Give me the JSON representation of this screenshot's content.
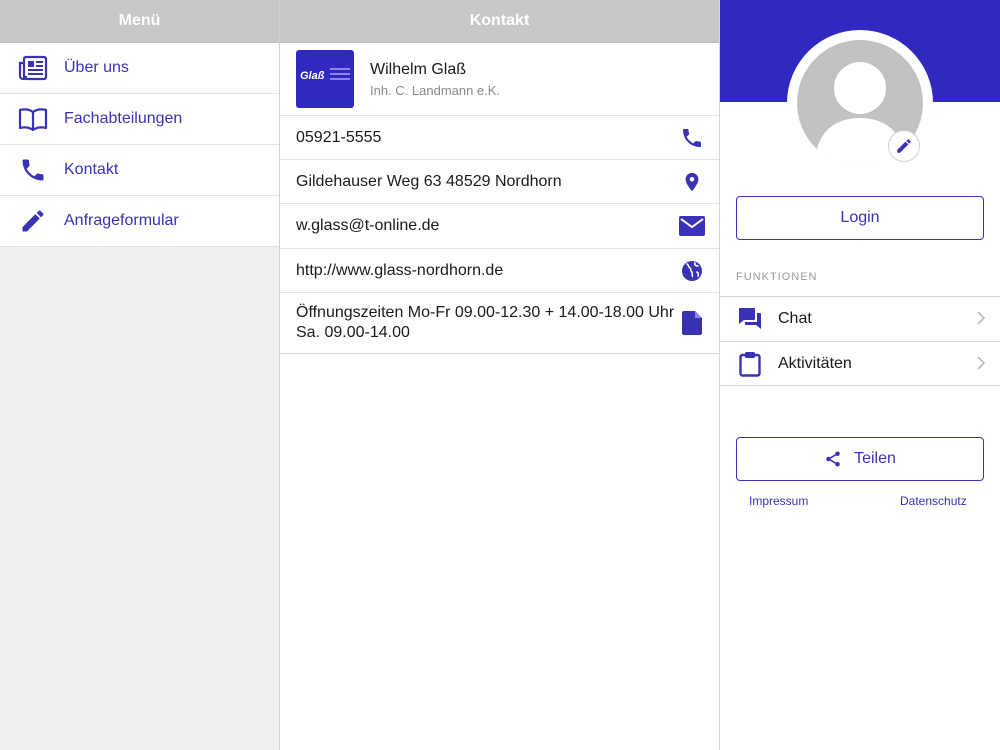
{
  "menu": {
    "title": "Menü",
    "items": [
      {
        "label": "Über uns",
        "icon": "newspaper-icon"
      },
      {
        "label": "Fachabteilungen",
        "icon": "book-icon"
      },
      {
        "label": "Kontakt",
        "icon": "phone-icon"
      },
      {
        "label": "Anfrageformular",
        "icon": "pencil-icon"
      }
    ]
  },
  "contact": {
    "title": "Kontakt",
    "business": {
      "logo_text": "Glaß",
      "name": "Wilhelm Glaß",
      "subtitle": "Inh. C. Landmann e.K."
    },
    "rows": [
      {
        "text": "05921-5555",
        "icon": "phone-icon"
      },
      {
        "text": "Gildehauser Weg 63 48529 Nordhorn",
        "icon": "location-pin-icon"
      },
      {
        "text": "w.glass@t-online.de",
        "icon": "mail-icon"
      },
      {
        "text": "http://www.glass-nordhorn.de",
        "icon": "globe-icon"
      },
      {
        "text": "Öffnungszeiten Mo-Fr 09.00-12.30 + 14.00-18.00 Uhr Sa. 09.00-14.00",
        "icon": "document-icon"
      }
    ]
  },
  "profile": {
    "login_label": "Login",
    "section_label": "FUNKTIONEN",
    "functions": [
      {
        "label": "Chat",
        "icon": "chat-icon"
      },
      {
        "label": "Aktivitäten",
        "icon": "clipboard-icon"
      }
    ],
    "share_label": "Teilen",
    "impressum_label": "Impressum",
    "datenschutz_label": "Datenschutz"
  },
  "colors": {
    "accent": "#3a32b4",
    "banner": "#3128c2",
    "header_gray": "#c8c8ca"
  }
}
